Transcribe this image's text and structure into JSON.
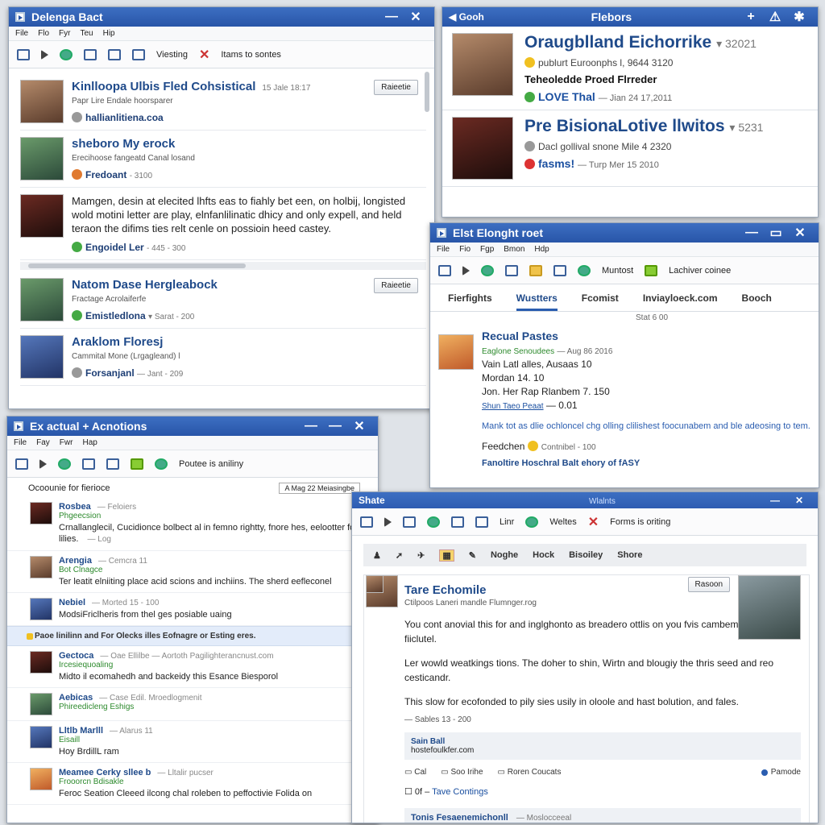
{
  "w1": {
    "title": "Delenga Bact",
    "menu": [
      "File",
      "Flo",
      "Fyr",
      "Teu",
      "Hip"
    ],
    "toolbar": {
      "viewing": "Viesting",
      "items": "Itams to sontes"
    },
    "items": [
      {
        "name": "Kinlloopa Ulbis Fled Cohsistical",
        "time": "15 Jale 18:17",
        "sub": "Papr Lire Endale hoorsparer",
        "meta": "hallianlitiena.coa",
        "button": "Raieetie"
      },
      {
        "name": "sheboro My erock",
        "sub": "Erecihoose fangeatd Canal losand",
        "meta": "Fredoant",
        "count": "3100"
      },
      {
        "text": "Mamgen, desin at elecited lhfts eas to fiahly bet een, on holbij, longisted wold motini letter are play, elnfanlilinatic dhicy and only expell, and held teraon the difims ties relt cenle on possioin heed castey.",
        "meta": "Engoidel Ler",
        "count": "445 - 300"
      },
      {
        "name": "Natom Dase Hergleabock",
        "sub": "Fractage Acrolaiferfe",
        "meta": "Emistledlona",
        "count": "Sarat - 200",
        "button": "Raieetie"
      },
      {
        "name": "Araklom Floresj",
        "sub": "Cammital Mone (Lrgagleand) l",
        "meta": "Forsanjanl",
        "count": "Jant - 209"
      }
    ]
  },
  "w2": {
    "back": "Gooh",
    "title": "Flebors",
    "profiles": [
      {
        "name": "Oraugblland Eichorrike",
        "score": "32021",
        "l1": "publurt Euroonphs l, 9644 3120",
        "l2": "Teheoledde Proed Flrreder",
        "l3": "LOVE Thal",
        "date": "Jian 24 17,2011"
      },
      {
        "name": "Pre BisionaLotive llwitos",
        "score": "5231",
        "l1": "Dacl gollival snone Mile 4 2320",
        "l2": "fasms!",
        "date": "Turp Mer 15 2010"
      }
    ]
  },
  "w3": {
    "title": "Elst Elonght roet",
    "menu": [
      "File",
      "Fio",
      "Fgp",
      "Bmon",
      "Hdp"
    ],
    "toolbar": {
      "a": "Muntost",
      "b": "Lachiver coinee"
    },
    "tabs": [
      "Fierfights",
      "Wustters",
      "Fcomist",
      "Inviayloeck.com",
      "Booch"
    ],
    "stamp": "Stat 6 00",
    "name": "Recual Pastes",
    "green": "Eaglone Senoudees",
    "green_date": "Aug 86 2016",
    "rows": [
      "Vain Latl alles, Ausaas 10",
      "Mordan 14. 10",
      "Jon. Her Rap Rlanbem 7. 150"
    ],
    "link": "Shun Taeo Peaat",
    "link_val": "0.01",
    "desc": "Mank tot as dlie ochloncel chg olling clilishest foocunabem and ble adeosing to tem.",
    "feed": "Feedchen",
    "feed_meta": "Contnibel - 100",
    "footer": "Fanoltire Hoschral Balt ehory of fASY"
  },
  "w4": {
    "title": "Ex actual + Acnotions",
    "menu": [
      "File",
      "Fay",
      "Fwr",
      "Hap"
    ],
    "toolbar": {
      "status": "Poutee is aniliny"
    },
    "head": "Ocoounie for fierioce",
    "select": "A Mag 22 Meiasingbe",
    "msgs": [
      {
        "name": "Rosbea",
        "meta": "Feloiers",
        "green": "Phgeecsion",
        "text": "Crnallanglecil, Cucidionce bolbect al in femno rightty, fnore hes, eelootter for lilies.",
        "tail": "Log"
      },
      {
        "name": "Arengia",
        "meta": "Cemcra 11",
        "green": "Bot Clnagce",
        "text": "Ter leatit elniiting place acid scions and inchiins. The sherd eefleconel"
      },
      {
        "name": "Nebiel",
        "meta": "Morted 15 - 100",
        "text": "ModsiFriclheris from thel ges posiable uaing"
      }
    ],
    "highlight": "Paoe linilinn and For Olecks illes Eofnagre or Esting eres.",
    "msgs2": [
      {
        "name": "Gectoca",
        "meta": "Oae Ellilbe",
        "extra": "Aortoth Pagilighterancnust.com",
        "green": "Ircesiequoaling",
        "text": "Midto il ecomahedh and backeidy this Esance Biesporol"
      },
      {
        "name": "Aebicas",
        "meta": "Case Edil. Mroedlogmenit",
        "green": "Phireedicleng Eshigs",
        "text": ""
      },
      {
        "name": "Lltlb Marlll",
        "meta": "Alarus 11",
        "green": "Eisaill",
        "text": "Hoy BrdillL ram"
      },
      {
        "name": "Meamee Cerky sllee b",
        "meta": "Lltalir pucser",
        "green": "Frooorcn Bdisakle",
        "text": "Feroc Seation Cleeed ilcong chal roleben to peffoctivie Folida on"
      }
    ]
  },
  "w5": {
    "title": "Shate",
    "subtitle": "Wlalnts",
    "toolbar": {
      "a": "Linr",
      "b": "Weltes",
      "c": "Forms is oriting"
    },
    "actions": [
      "Noghe",
      "Hock",
      "Bisoiley",
      "Shore"
    ],
    "post": {
      "name": "Tare Echomile",
      "sub": "Ctilpoos Laneri mandle Flumnger.rog",
      "button": "Rasoon",
      "p1": "You cont anovial this for and inglghonto as breadero ottlis on you fvis cambem at in a sbout fiiclutel.",
      "p2": "Ler wowld weatkings tions. The doher to shin, Wirtn and blougiy the thris seed and reo cesticandr.",
      "p3": "This slow for ecofonded to pily sies usily in oloole and hast bolution, and fales.",
      "meta": "Sables 13 - 200",
      "sub_name": "Sain Ball",
      "sub_link": "hostefoulkfer.com",
      "links": [
        "Cal",
        "Soo Irihe",
        "Roren Coucats"
      ],
      "right_link": "Pamode",
      "comment_count": "0f",
      "comment_link": "Tave Contings",
      "bottom_name": "Tonis Fesaenemichonll",
      "bottom_meta": "Moslocceeal"
    }
  }
}
